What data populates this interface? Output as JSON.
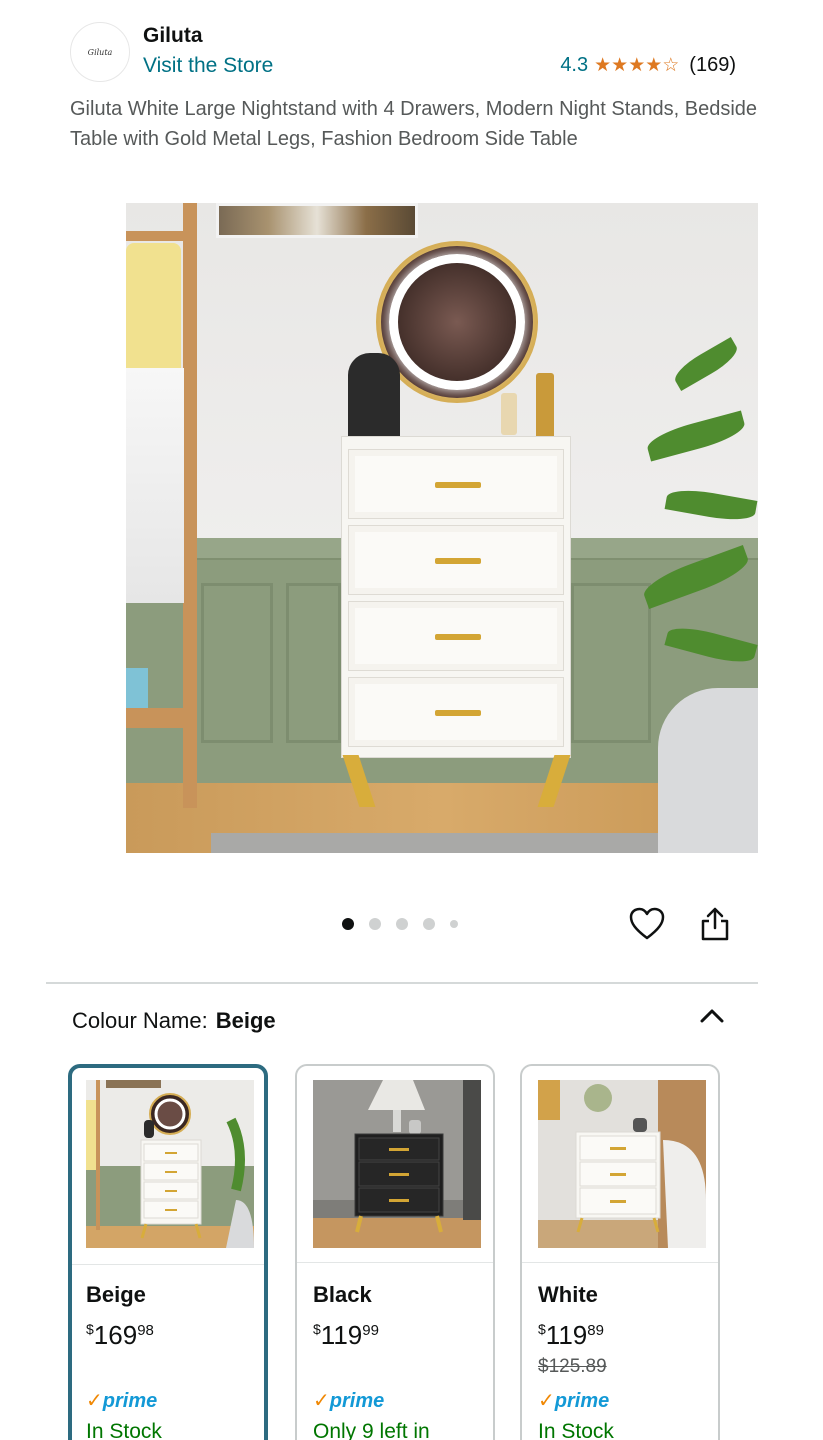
{
  "store": {
    "logo_text": "Giluta",
    "name": "Giluta",
    "visit_label": "Visit the Store",
    "rating": "4.3",
    "stars": "★★★★☆",
    "review_count": "(169)"
  },
  "product": {
    "title": "Giluta White Large Nightstand with 4 Drawers, Modern Night Stands, Bedside Table with Gold Metal Legs, Fashion Bedroom Side Table"
  },
  "gallery": {
    "image_count": 5,
    "active_index": 0,
    "favorite_icon": "heart-icon",
    "share_icon": "share-icon"
  },
  "colour": {
    "label": "Colour Name:",
    "selected": "Beige"
  },
  "variants": [
    {
      "name": "Beige",
      "currency": "$",
      "price_whole": "169",
      "price_cents": "98",
      "old_price": "",
      "prime": "prime",
      "stock": "In Stock"
    },
    {
      "name": "Black",
      "currency": "$",
      "price_whole": "119",
      "price_cents": "99",
      "old_price": "",
      "prime": "prime",
      "stock": "Only 9 left in"
    },
    {
      "name": "White",
      "currency": "$",
      "price_whole": "119",
      "price_cents": "89",
      "old_price": "$125.89",
      "prime": "prime",
      "stock": "In Stock"
    }
  ],
  "colors": {
    "link": "#007185",
    "star": "#de7921",
    "prime_blue": "#1399d6",
    "in_stock": "#007600",
    "selected_border": "#2d6b80"
  }
}
